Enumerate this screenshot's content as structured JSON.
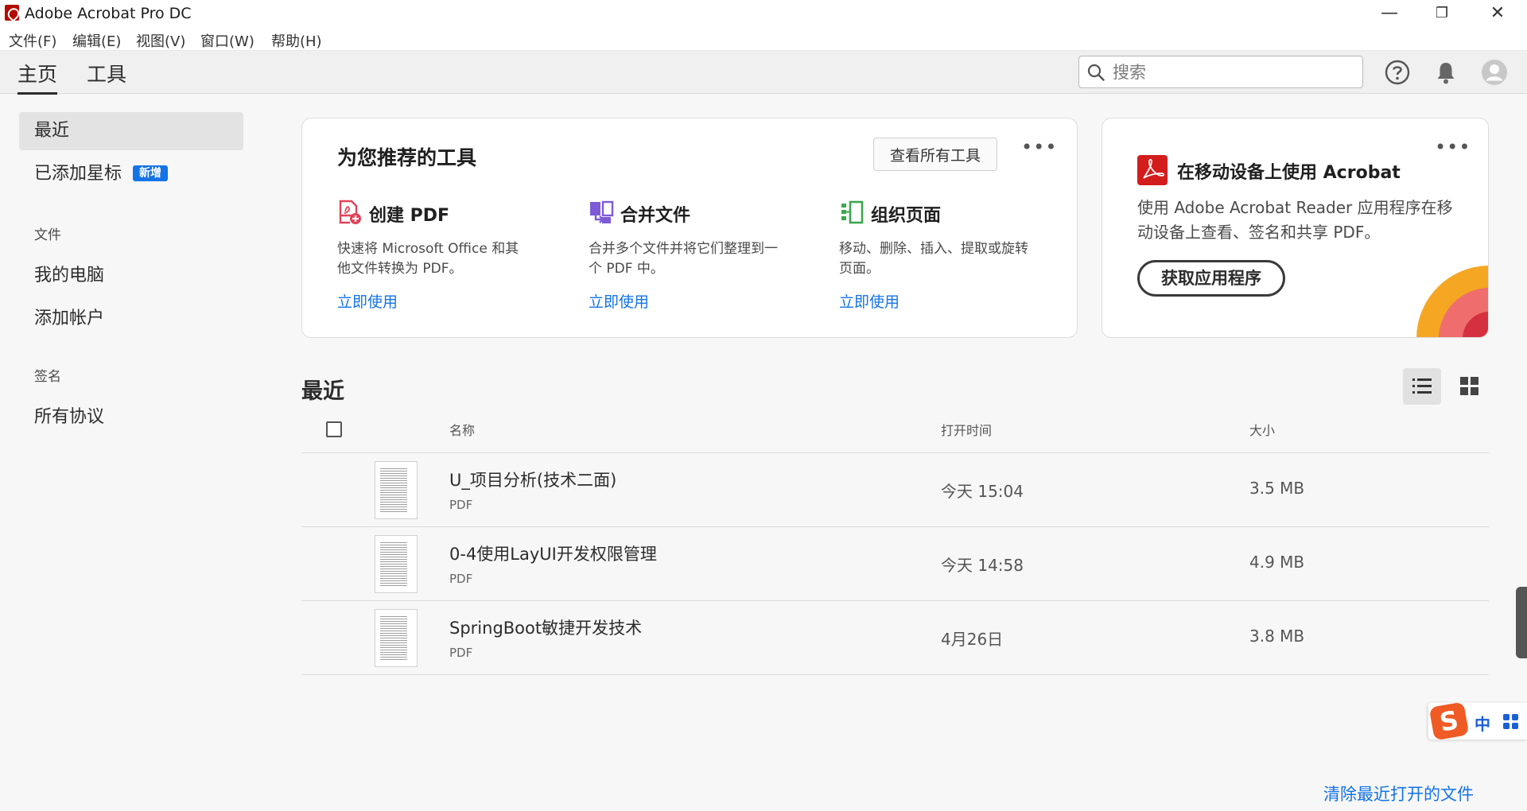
{
  "window": {
    "title": "Adobe Acrobat Pro DC",
    "minimize_glyph": "—",
    "restore_glyph": "❐",
    "close_glyph": "✕"
  },
  "menu": [
    "文件(F)",
    "编辑(E)",
    "视图(V)",
    "窗口(W)",
    "帮助(H)"
  ],
  "topnav": {
    "tabs": [
      "主页",
      "工具"
    ],
    "active_tab": "主页",
    "search_placeholder": "搜索"
  },
  "sidebar": {
    "recent": "最近",
    "starred": "已添加星标",
    "starred_badge": "新增",
    "files_heading": "文件",
    "my_computer": "我的电脑",
    "add_account": "添加帐户",
    "signature_heading": "签名",
    "all_agreements": "所有协议"
  },
  "tools_card": {
    "title": "为您推荐的工具",
    "view_all": "查看所有工具",
    "more": "•••",
    "tools": [
      {
        "name": "创建 PDF",
        "desc": "快速将 Microsoft Office 和其他文件转换为 PDF。",
        "link": "立即使用",
        "icon": "create-pdf-icon",
        "color": "#e0435a"
      },
      {
        "name": "合并文件",
        "desc": "合并多个文件并将它们整理到一个 PDF 中。",
        "link": "立即使用",
        "icon": "combine-files-icon",
        "color": "#7d5bd6"
      },
      {
        "name": "组织页面",
        "desc": "移动、删除、插入、提取或旋转页面。",
        "link": "立即使用",
        "icon": "organize-pages-icon",
        "color": "#3da74e"
      }
    ]
  },
  "mobile_card": {
    "title": "在移动设备上使用 Acrobat",
    "desc": "使用 Adobe Acrobat Reader 应用程序在移动设备上查看、签名和共享 PDF。",
    "button": "获取应用程序",
    "more": "•••"
  },
  "recent": {
    "title": "最近",
    "columns": {
      "name": "名称",
      "opened": "打开时间",
      "size": "大小"
    },
    "files": [
      {
        "name": "U_项目分析(技术二面)",
        "type": "PDF",
        "opened": "今天 15:04",
        "size": "3.5 MB"
      },
      {
        "name": "0-4使用LayUI开发权限管理",
        "type": "PDF",
        "opened": "今天 14:58",
        "size": "4.9 MB"
      },
      {
        "name": "SpringBoot敏捷开发技术",
        "type": "PDF",
        "opened": "4月26日",
        "size": "3.8 MB"
      }
    ],
    "clear_link": "清除最近打开的文件"
  },
  "ime": {
    "logo": "S",
    "mode": "中"
  },
  "colors": {
    "accent": "#1473e6",
    "acrobat_red": "#b30b00",
    "badge": "#1473e6"
  }
}
